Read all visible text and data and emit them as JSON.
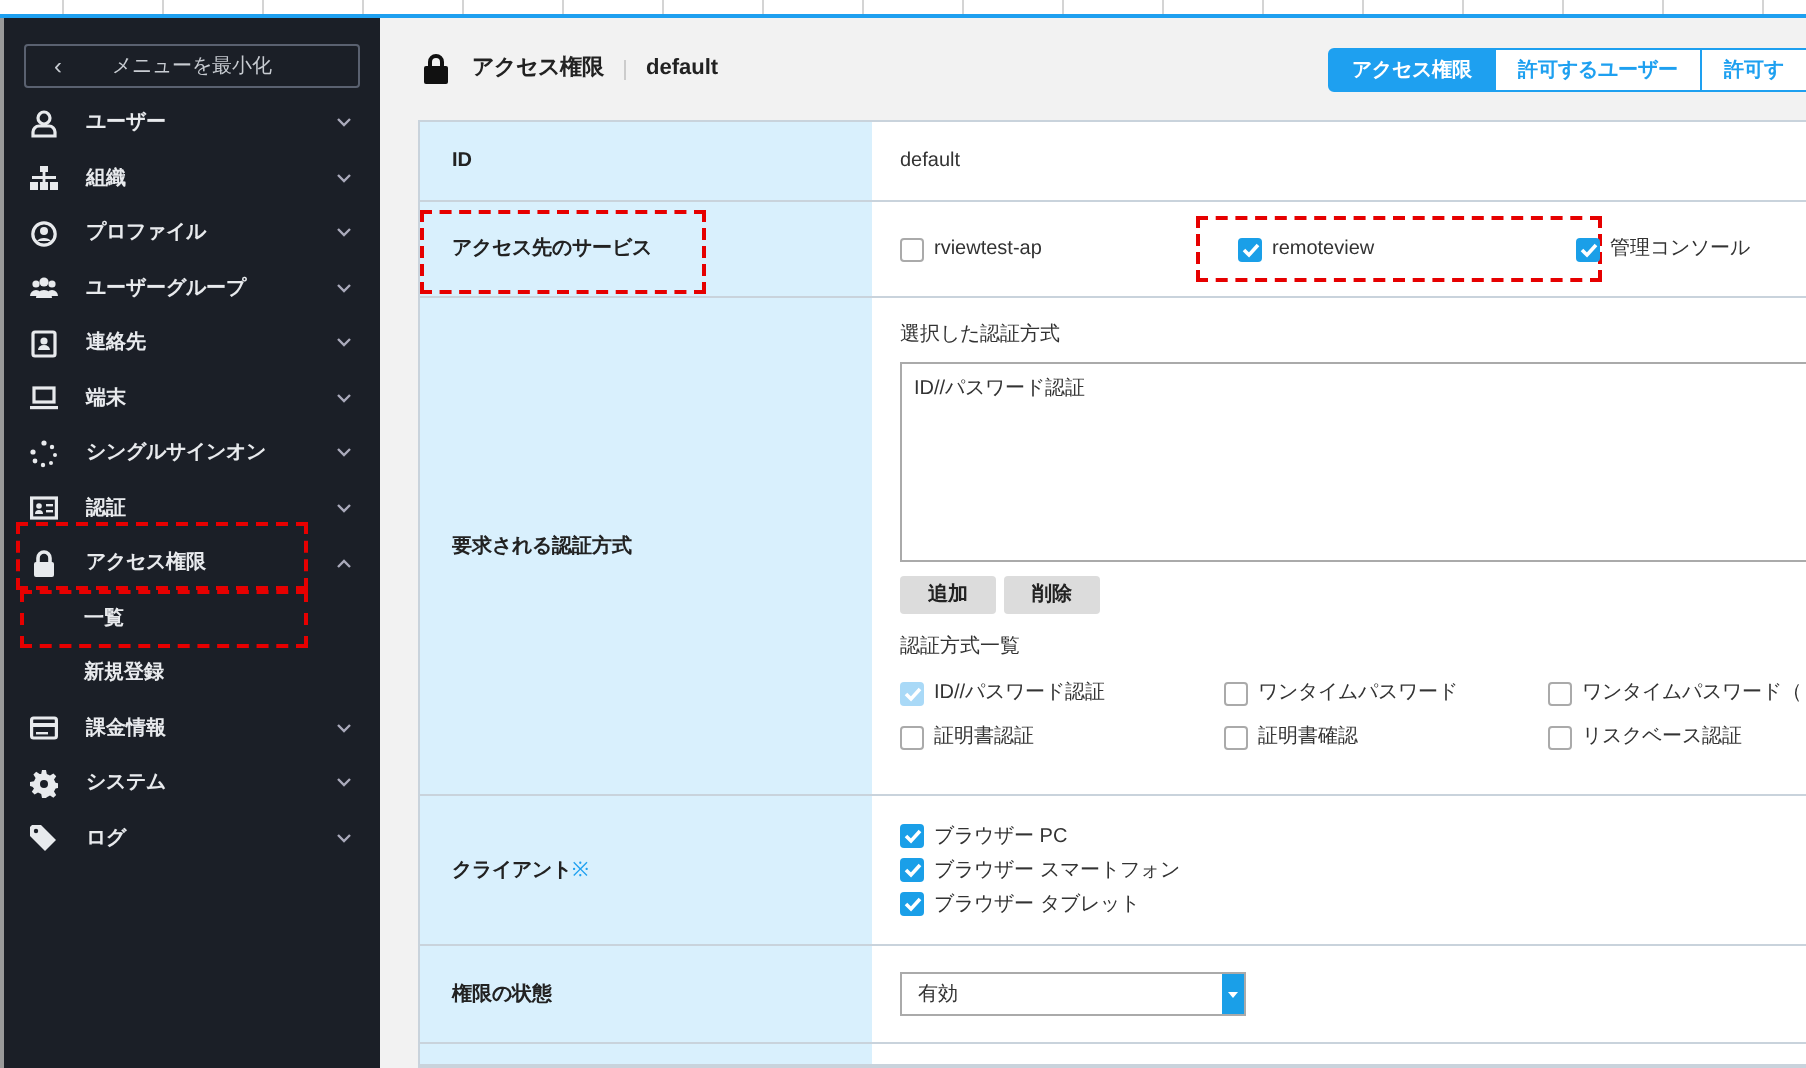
{
  "menu_toggle": {
    "icon": "‹",
    "label": "メニューを最小化"
  },
  "sidebar": {
    "items": [
      {
        "label": "ユーザー",
        "expanded": false,
        "highlighted": false
      },
      {
        "label": "組織",
        "expanded": false,
        "highlighted": false
      },
      {
        "label": "プロファイル",
        "expanded": false,
        "highlighted": false
      },
      {
        "label": "ユーザーグループ",
        "expanded": false,
        "highlighted": false
      },
      {
        "label": "連絡先",
        "expanded": false,
        "highlighted": false
      },
      {
        "label": "端末",
        "expanded": false,
        "highlighted": false
      },
      {
        "label": "シングルサインオン",
        "expanded": false,
        "highlighted": false
      },
      {
        "label": "認証",
        "expanded": false,
        "highlighted": false
      },
      {
        "label": "アクセス権限",
        "expanded": true,
        "highlighted": true,
        "children": [
          {
            "label": "一覧",
            "highlighted": true
          },
          {
            "label": "新規登録",
            "highlighted": false
          }
        ]
      },
      {
        "label": "課金情報",
        "expanded": false,
        "highlighted": false
      },
      {
        "label": "システム",
        "expanded": false,
        "highlighted": false
      },
      {
        "label": "ログ",
        "expanded": false,
        "highlighted": false
      }
    ]
  },
  "header": {
    "title": "アクセス権限",
    "name": "default"
  },
  "tabs": [
    {
      "label": "アクセス権限",
      "selected": true
    },
    {
      "label": "許可するユーザー",
      "selected": false
    },
    {
      "label": "許可す",
      "selected": false
    }
  ],
  "form": {
    "rows": [
      {
        "kind": "text",
        "label": "ID",
        "value": "default",
        "highlighted": false
      },
      {
        "kind": "options",
        "label": "アクセス先のサービス",
        "highlighted": true,
        "options": [
          {
            "label": "rviewtest-ap",
            "checked": false,
            "highlighted": false
          },
          {
            "label": "remoteview",
            "checked": true,
            "highlighted": true
          },
          {
            "label": "管理コンソール",
            "checked": true,
            "highlighted": false
          }
        ]
      },
      {
        "kind": "auth",
        "label": "要求される認証方式",
        "highlighted": false,
        "selected_caption": "選択した認証方式",
        "selected_methods": [
          "ID//パスワード認証"
        ],
        "buttons": [
          "追加",
          "削除"
        ],
        "list_caption": "認証方式一覧",
        "methods": [
          {
            "label": "ID//パスワード認証",
            "checked": true,
            "disabled": true
          },
          {
            "label": "ワンタイムパスワード",
            "checked": false,
            "disabled": false
          },
          {
            "label": "ワンタイムパスワード（",
            "checked": false,
            "disabled": false
          },
          {
            "label": "証明書認証",
            "checked": false,
            "disabled": false
          },
          {
            "label": "証明書確認",
            "checked": false,
            "disabled": false
          },
          {
            "label": "リスクベース認証",
            "checked": false,
            "disabled": false
          }
        ]
      },
      {
        "kind": "client",
        "label": "クライアント",
        "required_mark": "※",
        "highlighted": false,
        "options": [
          {
            "label": "ブラウザー PC",
            "checked": true
          },
          {
            "label": "ブラウザー スマートフォン",
            "checked": true
          },
          {
            "label": "ブラウザー タブレット",
            "checked": true
          }
        ]
      },
      {
        "kind": "select",
        "label": "権限の状態",
        "value": "有効",
        "highlighted": false
      },
      {
        "kind": "blank"
      }
    ]
  }
}
